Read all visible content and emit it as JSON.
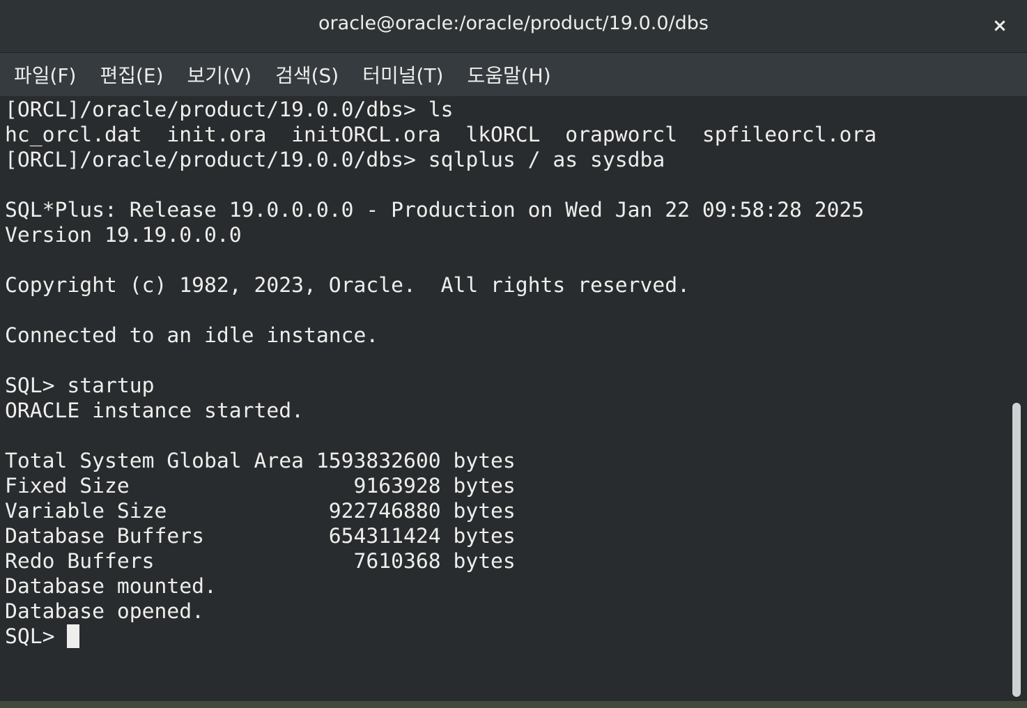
{
  "window": {
    "title": "oracle@oracle:/oracle/product/19.0.0/dbs",
    "close_label": "×"
  },
  "menu": {
    "items": [
      {
        "label": "파일(F)"
      },
      {
        "label": "편집(E)"
      },
      {
        "label": "보기(V)"
      },
      {
        "label": "검색(S)"
      },
      {
        "label": "터미널(T)"
      },
      {
        "label": "도움말(H)"
      }
    ]
  },
  "terminal": {
    "lines": [
      "[ORCL]/oracle/product/19.0.0/dbs> ls",
      "hc_orcl.dat  init.ora  initORCL.ora  lkORCL  orapworcl  spfileorcl.ora",
      "[ORCL]/oracle/product/19.0.0/dbs> sqlplus / as sysdba",
      "",
      "SQL*Plus: Release 19.0.0.0.0 - Production on Wed Jan 22 09:58:28 2025",
      "Version 19.19.0.0.0",
      "",
      "Copyright (c) 1982, 2023, Oracle.  All rights reserved.",
      "",
      "Connected to an idle instance.",
      "",
      "SQL> startup",
      "ORACLE instance started.",
      "",
      "Total System Global Area 1593832600 bytes",
      "Fixed Size                  9163928 bytes",
      "Variable Size             922746880 bytes",
      "Database Buffers          654311424 bytes",
      "Redo Buffers                7610368 bytes",
      "Database mounted.",
      "Database opened.",
      "SQL> "
    ]
  },
  "colors": {
    "background": "#292c2e",
    "text": "#eeeeec",
    "titlebar": "#2e3436",
    "menubar": "#353b3e"
  }
}
